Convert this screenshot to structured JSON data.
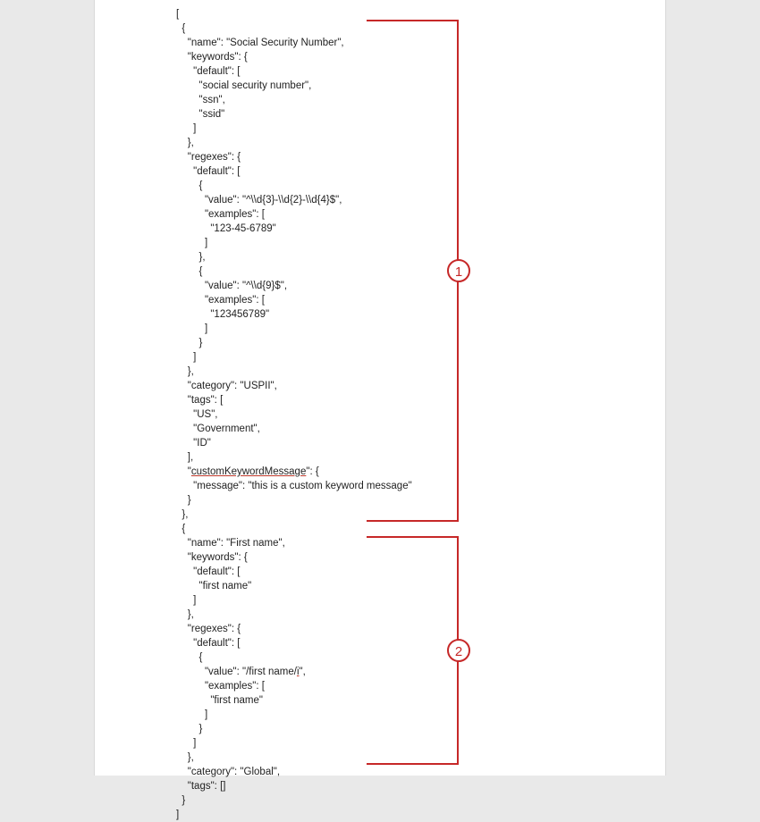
{
  "annotations": {
    "callout1": "1",
    "callout2": "2"
  },
  "code": {
    "lines": [
      "[",
      "  {",
      "    \"name\": \"Social Security Number\",",
      "    \"keywords\": {",
      "      \"default\": [",
      "        \"social security number\",",
      "        \"ssn\",",
      "        \"ssid\"",
      "      ]",
      "    },",
      "    \"regexes\": {",
      "      \"default\": [",
      "        {",
      "          \"value\": \"^\\\\d{3}-\\\\d{2}-\\\\d{4}$\",",
      "          \"examples\": [",
      "            \"123-45-6789\"",
      "          ]",
      "        },",
      "        {",
      "          \"value\": \"^\\\\d{9}$\",",
      "          \"examples\": [",
      "            \"123456789\"",
      "          ]",
      "        }",
      "      ]",
      "    },",
      "    \"category\": \"USPII\",",
      "    \"tags\": [",
      "      \"US\",",
      "      \"Government\",",
      "      \"ID\"",
      "    ],",
      "    \"<u class='underline'>customKeywordMessage</u>\": {",
      "      \"message\": \"this is a custom keyword message\"",
      "    }",
      "  },",
      "  {",
      "    \"name\": \"First name\",",
      "    \"keywords\": {",
      "      \"default\": [",
      "        \"first name\"",
      "      ]",
      "    },",
      "    \"regexes\": {",
      "      \"default\": [",
      "        {",
      "          \"value\": \"/first name/<u class='underline'>i</u>\",",
      "          \"examples\": [",
      "            \"first name\"",
      "          ]",
      "        }",
      "      ]",
      "    },",
      "    \"category\": \"Global\",",
      "    \"tags\": []",
      "  }",
      "]"
    ]
  },
  "parsed_config": [
    {
      "name": "Social Security Number",
      "keywords": {
        "default": [
          "social security number",
          "ssn",
          "ssid"
        ]
      },
      "regexes": {
        "default": [
          {
            "value": "^\\d{3}-\\d{2}-\\d{4}$",
            "examples": [
              "123-45-6789"
            ]
          },
          {
            "value": "^\\d{9}$",
            "examples": [
              "123456789"
            ]
          }
        ]
      },
      "category": "USPII",
      "tags": [
        "US",
        "Government",
        "ID"
      ],
      "customKeywordMessage": {
        "message": "this is a custom keyword message"
      }
    },
    {
      "name": "First name",
      "keywords": {
        "default": [
          "first name"
        ]
      },
      "regexes": {
        "default": [
          {
            "value": "/first name/i",
            "examples": [
              "first name"
            ]
          }
        ]
      },
      "category": "Global",
      "tags": []
    }
  ]
}
